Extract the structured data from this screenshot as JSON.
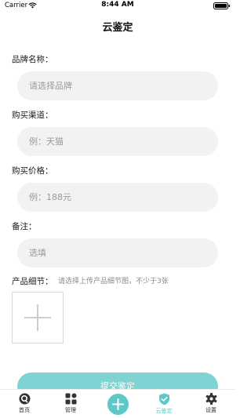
{
  "status": {
    "carrier": "Carrier",
    "time": "8:44 AM"
  },
  "nav": {
    "title": "云鉴定"
  },
  "form": {
    "brand_label": "品牌名称：",
    "brand_placeholder": "请选择品牌",
    "channel_label": "购买渠道：",
    "channel_placeholder": "例：天猫",
    "price_label": "购买价格：",
    "price_placeholder": "例：188元",
    "note_label": "备注：",
    "note_placeholder": "选填",
    "detail_label": "产品细节：",
    "detail_hint": "请选择上传产品细节图，不少于3张",
    "submit_label": "提交鉴定"
  },
  "tabbar": {
    "items": [
      {
        "label": "首页",
        "icon": "home-icon"
      },
      {
        "label": "管理",
        "icon": "grid-icon"
      },
      {
        "label": "",
        "icon": "add-icon"
      },
      {
        "label": "云鉴定",
        "icon": "shield-check-icon",
        "active": true
      },
      {
        "label": "设置",
        "icon": "gear-icon"
      }
    ],
    "accent": "#5cc8c8"
  },
  "colors": {
    "accent": "#5cc8c8",
    "button": "#7fd3d3",
    "input_bg": "#f2f2f2"
  }
}
